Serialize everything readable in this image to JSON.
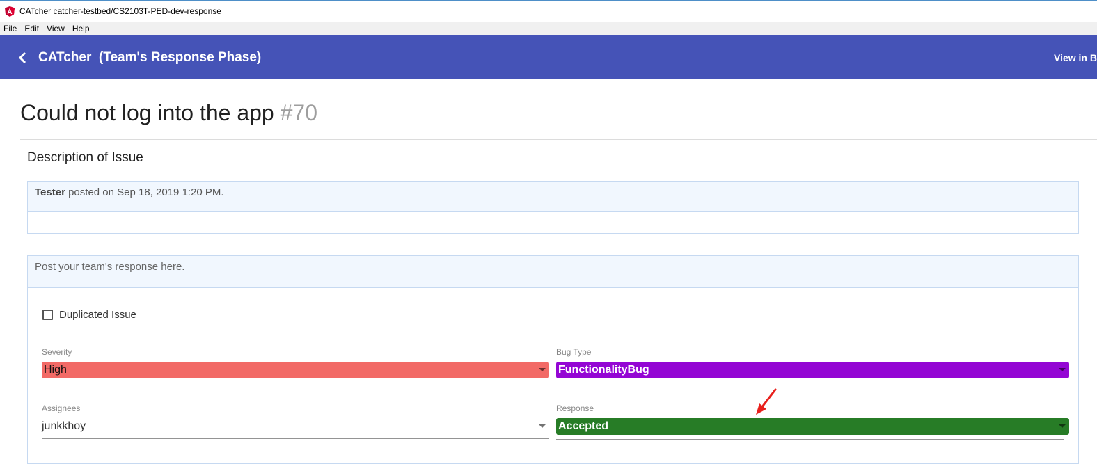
{
  "window": {
    "title": "CATcher catcher-testbed/CS2103T-PED-dev-response",
    "app_icon": "angular-icon"
  },
  "menu": {
    "items": [
      "File",
      "Edit",
      "View",
      "Help"
    ]
  },
  "toolbar": {
    "title": "CATcher  (Team's Response Phase)",
    "view_in_browser": "View in Browser",
    "back_icon": "chevron-left-icon",
    "color": "#4553b7"
  },
  "issue": {
    "title": "Could not log into the app",
    "number": "#70"
  },
  "description": {
    "section_title": "Description of Issue",
    "author": "Tester",
    "posted_text": "posted on Sep 18, 2019 1:20 PM."
  },
  "response": {
    "placeholder": "Post your team's response here.",
    "duplicated_label": "Duplicated Issue",
    "duplicated_checked": false,
    "severity": {
      "label": "Severity",
      "value": "High",
      "color": "#f26a66"
    },
    "bug_type": {
      "label": "Bug Type",
      "value": "FunctionalityBug",
      "color": "#9406d4"
    },
    "assignees": {
      "label": "Assignees",
      "value": "junkkhoy"
    },
    "response_field": {
      "label": "Response",
      "value": "Accepted",
      "color": "#277c26"
    }
  },
  "annotation": {
    "icon": "red-arrow-icon",
    "color": "#e8201c"
  }
}
